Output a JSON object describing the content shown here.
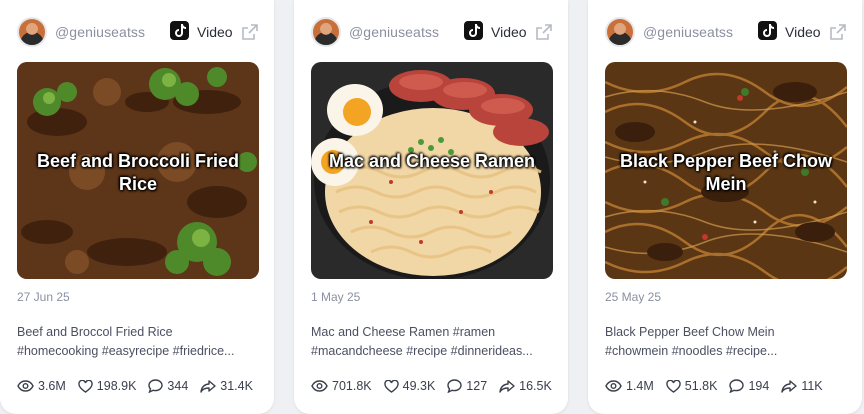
{
  "cards": [
    {
      "handle": "@geniuseatss",
      "type_label": "Video",
      "thumb_title": "Beef and Broccoli Fried Rice",
      "date": "27 Jun 25",
      "caption_line1": "Beef and Broccol Fried Rice",
      "caption_line2": "#homecooking #easyrecipe #friedrice...",
      "views": "3.6M",
      "likes": "198.9K",
      "comments": "344",
      "shares": "31.4K"
    },
    {
      "handle": "@geniuseatss",
      "type_label": "Video",
      "thumb_title": "Mac and Cheese Ramen",
      "date": "1 May 25",
      "caption_line1": "Mac and Cheese Ramen #ramen",
      "caption_line2": "#macandcheese #recipe #dinnerideas...",
      "views": "701.8K",
      "likes": "49.3K",
      "comments": "127",
      "shares": "16.5K"
    },
    {
      "handle": "@geniuseatss",
      "type_label": "Video",
      "thumb_title": "Black Pepper Beef Chow Mein",
      "date": "25 May 25",
      "caption_line1": "Black Pepper Beef Chow Mein",
      "caption_line2": "#chowmein #noodles #recipe...",
      "views": "1.4M",
      "likes": "51.8K",
      "comments": "194",
      "shares": "11K"
    }
  ],
  "colors": {
    "card_bg": "#ffffff",
    "page_bg": "#eef0f3",
    "muted_text": "#8a90a0",
    "body_text": "#4b5060"
  },
  "icons": [
    "avatar",
    "tiktok-icon",
    "external-link-icon",
    "eye-icon",
    "heart-icon",
    "comment-icon",
    "share-icon"
  ]
}
